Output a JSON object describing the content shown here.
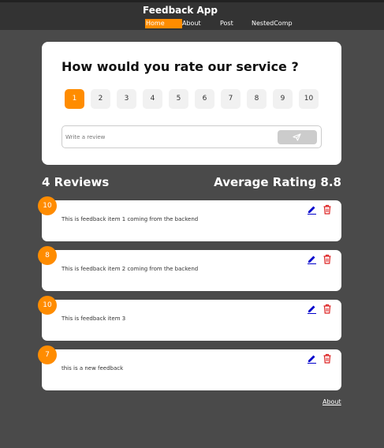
{
  "header": {
    "title": "Feedback App",
    "nav": [
      "Home",
      "About",
      "Post",
      "NestedComp"
    ],
    "active_nav": "Home"
  },
  "rating_card": {
    "title": "How would you rate our service ?",
    "options": [
      "1",
      "2",
      "3",
      "4",
      "5",
      "6",
      "7",
      "8",
      "9",
      "10"
    ],
    "selected": "1",
    "review_placeholder": "Write a review",
    "send_icon": "send-icon"
  },
  "stats": {
    "count_label": "4 Reviews",
    "average_label": "Average Rating 8.8"
  },
  "feedback": [
    {
      "rating": "10",
      "text": "This is feedback item 1 coming from the backend"
    },
    {
      "rating": "8",
      "text": "This is feedback item 2 coming from the backend"
    },
    {
      "rating": "10",
      "text": "This is feedback item 3"
    },
    {
      "rating": "7",
      "text": "this is a new feedback"
    }
  ],
  "footer": {
    "about_link": "About"
  },
  "colors": {
    "accent": "#ff8c00",
    "background": "#4a4a4a",
    "header": "#333333",
    "edit_icon": "#0000cc",
    "delete_icon": "#dd2222"
  }
}
